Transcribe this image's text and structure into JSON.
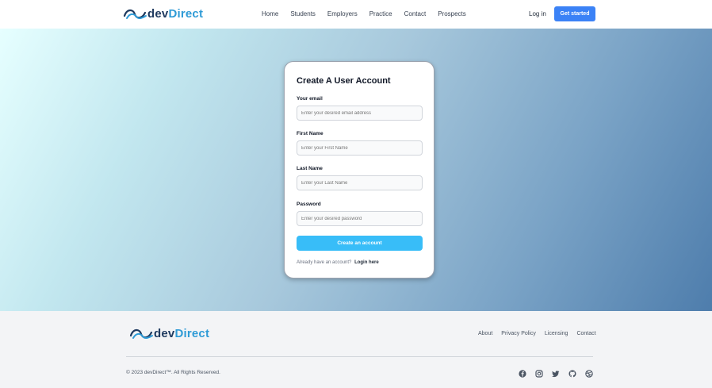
{
  "brand": {
    "dev": "dev",
    "direct": "Direct"
  },
  "header": {
    "nav": [
      "Home",
      "Students",
      "Employers",
      "Practice",
      "Contact",
      "Prospects"
    ],
    "login": "Log in",
    "cta": "Get started"
  },
  "form": {
    "title": "Create A User Account",
    "email": {
      "label": "Your email",
      "placeholder": "Enter your desired email address"
    },
    "first_name": {
      "label": "First Name",
      "placeholder": "Enter your First Name"
    },
    "last_name": {
      "label": "Last Name",
      "placeholder": "Enter your Last Name"
    },
    "password": {
      "label": "Password",
      "placeholder": "Enter your desired password"
    },
    "submit": "Create an account",
    "signin_prompt": "Already have an account?",
    "signin_link": "Login here"
  },
  "footer": {
    "links": [
      "About",
      "Privacy Policy",
      "Licensing",
      "Contact"
    ],
    "copyright": "© 2023 devDirect™. All Rights Reserved.",
    "socials": [
      "facebook-icon",
      "instagram-icon",
      "twitter-icon",
      "github-icon",
      "dribbble-icon"
    ]
  },
  "colors": {
    "primary": "#3b82f6",
    "submit": "#38bdf8",
    "brand_dark": "#1f3a5f",
    "brand_light": "#2f9bd6"
  }
}
